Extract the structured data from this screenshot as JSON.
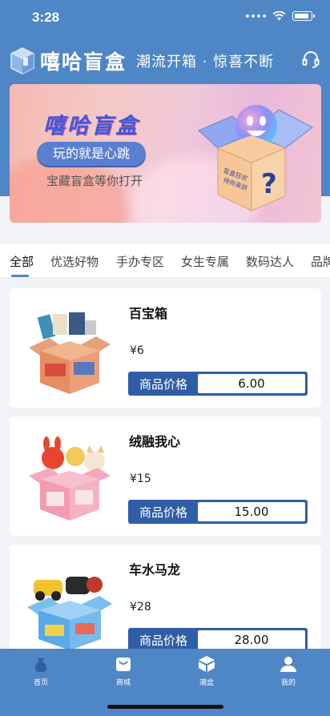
{
  "status_bar": {
    "time": "3:28"
  },
  "header": {
    "app_name": "嘻哈盲盒",
    "slogan": "潮流开箱 · 惊喜不断",
    "support_icon": "headset-icon"
  },
  "banner": {
    "title": "嘻哈盲盒",
    "pill_text": "玩的就是心跳",
    "subtitle": "宝藏盲盒等你打开",
    "box_side_text": "盲盒狂欢 待你来拆",
    "box_front_text": "?"
  },
  "tabs": [
    {
      "label": "全部",
      "active": true
    },
    {
      "label": "优选好物"
    },
    {
      "label": "手办专区"
    },
    {
      "label": "女生专属"
    },
    {
      "label": "数码达人"
    },
    {
      "label": "品牌"
    }
  ],
  "products": [
    {
      "name": "百宝箱",
      "price": "¥6",
      "price_label": "商品价格",
      "price_value": "6.00",
      "box_color": "#e9a07b",
      "image": "treasure-box-image"
    },
    {
      "name": "绒融我心",
      "price": "¥15",
      "price_label": "商品价格",
      "price_value": "15.00",
      "box_color": "#f4a9bd",
      "image": "plush-box-image"
    },
    {
      "name": "车水马龙",
      "price": "¥28",
      "price_label": "商品价格",
      "price_value": "28.00",
      "box_color": "#6fb4e8",
      "image": "car-box-image"
    }
  ],
  "bottom_nav": [
    {
      "label": "首页",
      "icon": "home-icon"
    },
    {
      "label": "商城",
      "icon": "shop-icon"
    },
    {
      "label": "潮盒",
      "icon": "box-icon"
    },
    {
      "label": "我的",
      "icon": "profile-icon"
    }
  ],
  "colors": {
    "primary": "#4f86c6",
    "price_field": "#2f5ea7"
  }
}
